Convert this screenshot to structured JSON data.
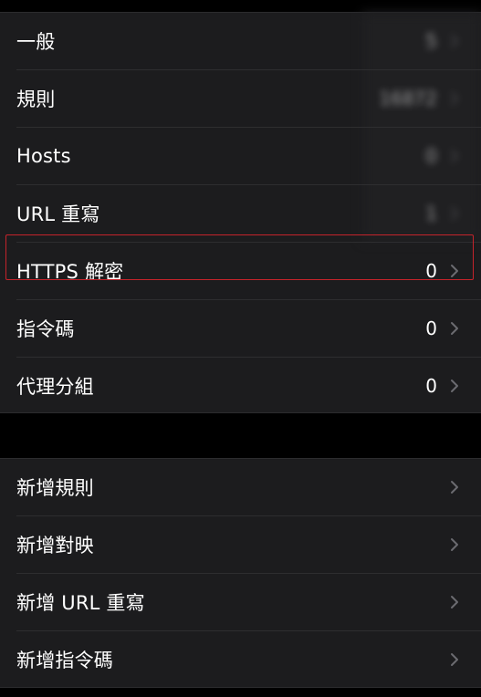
{
  "status_colors": {
    "highlight": "#c4232b",
    "chevron": "#6b6b70"
  },
  "icons": {
    "disclosure": "chevron-right-icon"
  },
  "settings_group": {
    "items": [
      {
        "label": "一般",
        "value": "5"
      },
      {
        "label": "規則",
        "value": "16872"
      },
      {
        "label": "Hosts",
        "value": "0"
      },
      {
        "label": "URL 重寫",
        "value": "1"
      },
      {
        "label": "HTTPS 解密",
        "value": "0"
      },
      {
        "label": "指令碼",
        "value": "0"
      },
      {
        "label": "代理分組",
        "value": "0"
      }
    ]
  },
  "actions_group": {
    "items": [
      {
        "label": "新增規則"
      },
      {
        "label": "新增對映"
      },
      {
        "label": "新增 URL 重寫"
      },
      {
        "label": "新增指令碼"
      }
    ]
  }
}
